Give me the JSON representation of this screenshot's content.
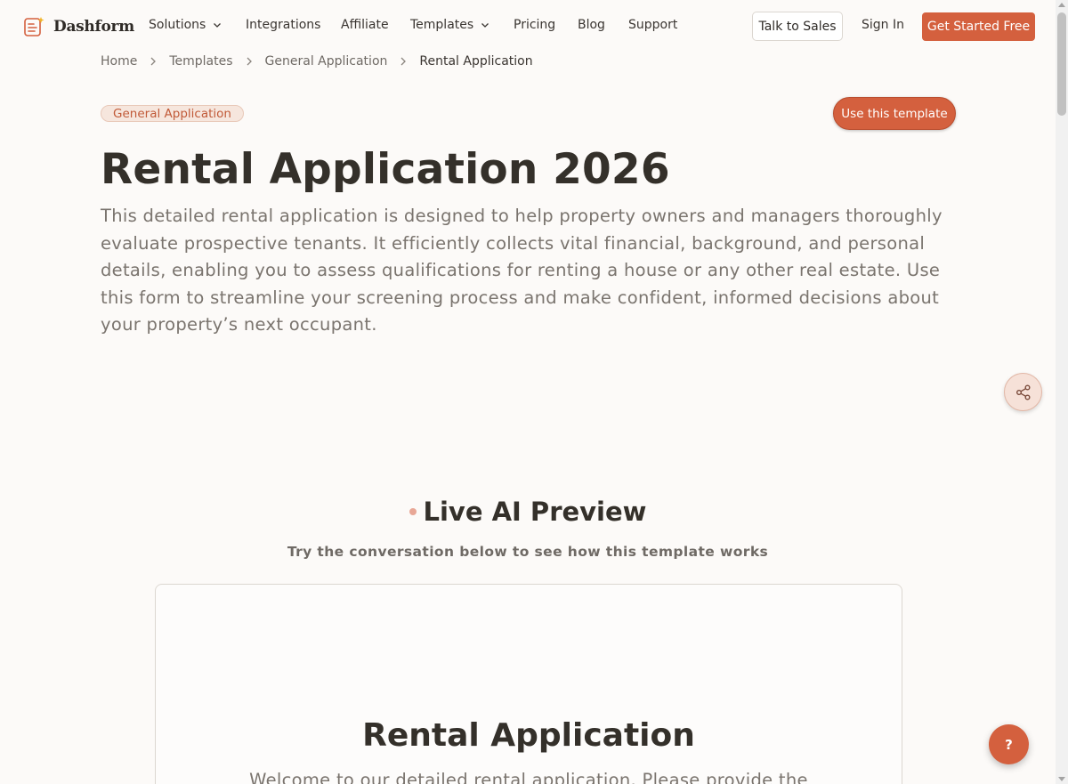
{
  "brand": {
    "name": "Dashform",
    "accent": "#d4603e"
  },
  "nav": {
    "items": [
      {
        "label": "Solutions",
        "dropdown": true
      },
      {
        "label": "Integrations",
        "dropdown": false
      },
      {
        "label": "Affiliate",
        "dropdown": false
      },
      {
        "label": "Templates",
        "dropdown": true
      },
      {
        "label": "Pricing",
        "dropdown": false
      },
      {
        "label": "Blog",
        "dropdown": false
      },
      {
        "label": "Support",
        "dropdown": false
      }
    ],
    "talk_to_sales": "Talk to Sales",
    "sign_in": "Sign In",
    "get_started": "Get Started Free"
  },
  "breadcrumb": [
    "Home",
    "Templates",
    "General Application",
    "Rental Application"
  ],
  "template": {
    "category": "General Application",
    "use_label": "Use this template",
    "title": "Rental Application 2026",
    "description": "This detailed rental application is designed to help property owners and managers thoroughly evaluate prospective tenants. It efficiently collects vital financial, background, and personal details, enabling you to assess qualifications for renting a house or any other real estate. Use this form to streamline your screening process and make confident, informed decisions about your property’s next occupant."
  },
  "preview": {
    "title": "Live AI Preview",
    "subtitle": "Try the conversation below to see how this template works",
    "form_title": "Rental Application",
    "form_intro": "Welcome to our detailed rental application. Please provide the"
  },
  "help_label": "?"
}
